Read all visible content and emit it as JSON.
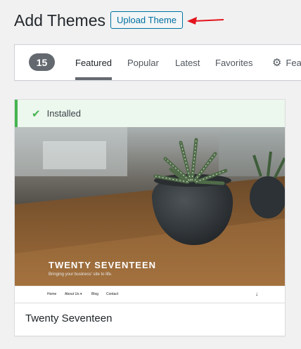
{
  "header": {
    "title": "Add Themes",
    "upload_label": "Upload Theme",
    "arrow_color": "#e3141c"
  },
  "filters": {
    "count": "15",
    "tabs": [
      {
        "label": "Featured",
        "current": true
      },
      {
        "label": "Popular",
        "current": false
      },
      {
        "label": "Latest",
        "current": false
      },
      {
        "label": "Favorites",
        "current": false
      },
      {
        "label": "Fea",
        "icon": "gear-icon"
      }
    ]
  },
  "theme": {
    "installed_label": "Installed",
    "name": "Twenty Seventeen",
    "preview": {
      "site_title": "TWENTY SEVENTEEN",
      "tagline": "Bringing your business' site to life.",
      "nav": [
        "Home",
        "About Us ▾",
        "Blog",
        "Contact"
      ],
      "scroll_icon": "↓"
    }
  },
  "colors": {
    "installed_green": "#46b450",
    "link_blue": "#0071a1",
    "count_badge": "#646970"
  }
}
